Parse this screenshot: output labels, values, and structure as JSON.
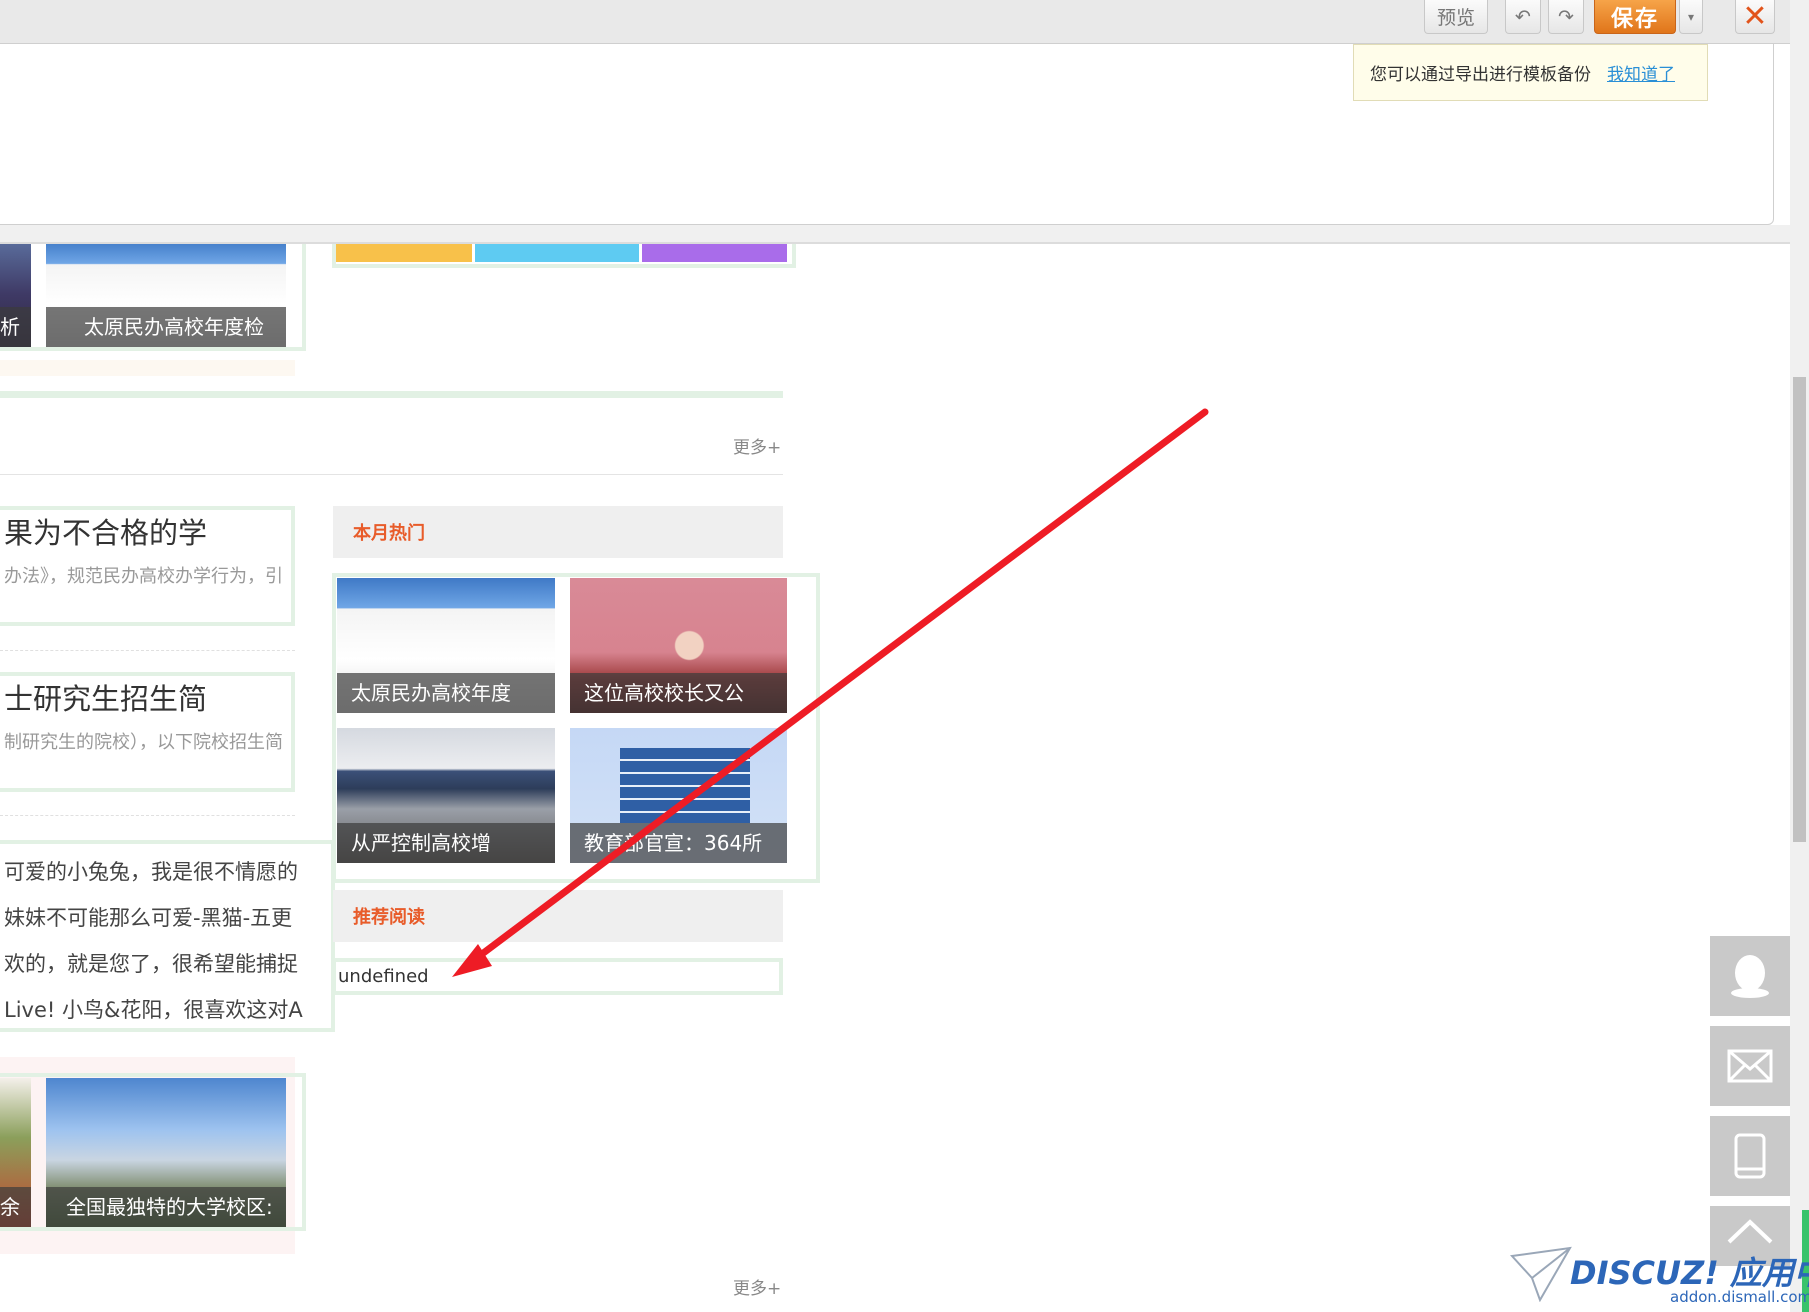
{
  "toolbar": {
    "preview_label": "预览",
    "save_label": "保存",
    "close_symbol": "✕",
    "tip_text": "您可以通过导出进行模板备份",
    "tip_link": "我知道了"
  },
  "colors": {
    "accent_orange": "#e0751a",
    "heading_red": "#e85c2a",
    "border_green": "#e2f1e4",
    "arrow_red": "#ee1c25",
    "link_blue": "#2a8fd6"
  },
  "top_section": {
    "thumb_partial_caption": "析",
    "thumb_caption": "太原民办高校年度检",
    "color_bars": [
      "#f8c14a",
      "#5ecbf2",
      "#a96cea"
    ]
  },
  "news_section": {
    "more_label": "更多+",
    "articles": [
      {
        "title": "果为不合格的学",
        "summary": "办法》，规范民办高校办学行为，引"
      },
      {
        "title": "士研究生招生简",
        "summary": "制研究生的院校），以下院校招生简"
      }
    ],
    "list_items": [
      "可爱的小兔兔，我是很不情愿的",
      "妹妹不可能那么可爱-黑猫-五更",
      "欢的，就是您了，很希望能捕捉",
      "Live! 小鸟&花阳，很喜欢这对A"
    ]
  },
  "monthly_hot": {
    "heading": "本月热门",
    "items": [
      {
        "caption": "太原民办高校年度"
      },
      {
        "caption": "这位高校校长又公"
      },
      {
        "caption": "从严控制高校增"
      },
      {
        "caption": "教育部官宣：364所"
      }
    ]
  },
  "recommended": {
    "heading": "推荐阅读",
    "value": "undefined"
  },
  "bottom_section": {
    "partial_caption": "余",
    "caption": "全国最独特的大学校区:",
    "more_label": "更多+"
  },
  "float_buttons": [
    "qq-icon",
    "mail-icon",
    "mobile-icon",
    "back-to-top-icon"
  ],
  "watermark": {
    "main": "DISCUZ! 应用中心",
    "sub": "addon.dismall.com"
  }
}
